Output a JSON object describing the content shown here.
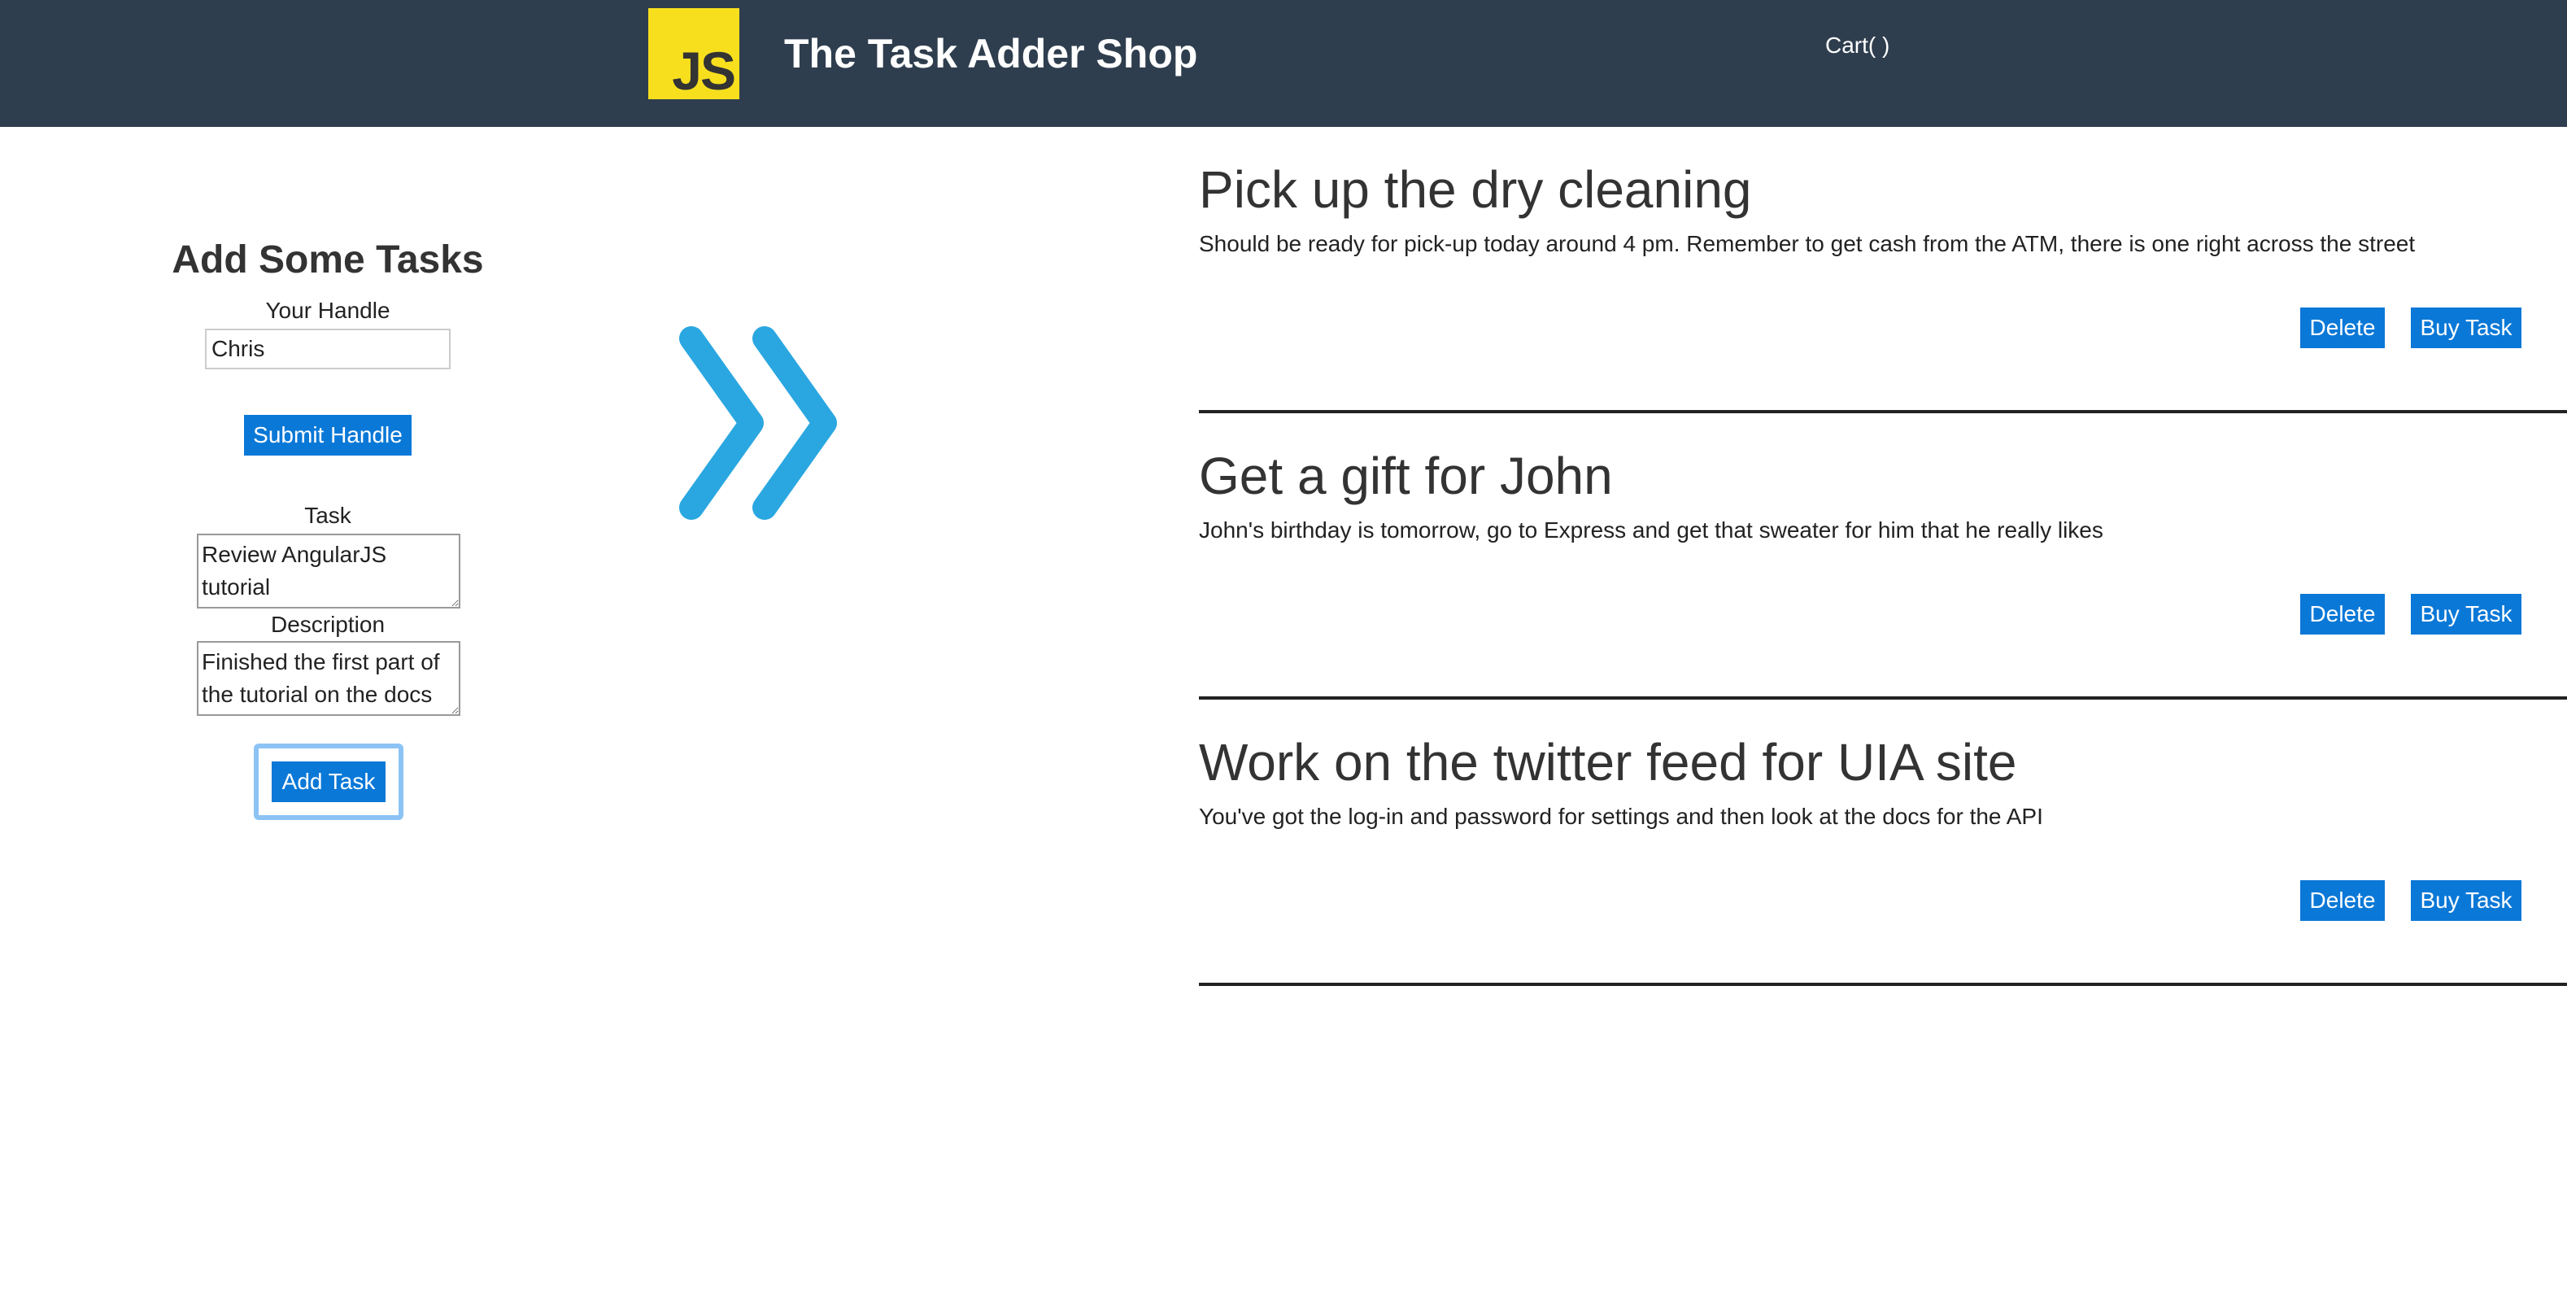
{
  "header": {
    "logo_text": "JS",
    "title": "The Task Adder Shop",
    "cart_label": "Cart( )"
  },
  "form": {
    "title": "Add Some Tasks",
    "handle_label": "Your Handle",
    "handle_value": "Chris",
    "submit_handle_label": "Submit Handle",
    "task_label": "Task",
    "task_value": "Review AngularJS tutorial",
    "description_label": "Description",
    "description_value": "Finished the first part of the tutorial on the docs",
    "add_task_label": "Add Task"
  },
  "tasks": [
    {
      "title": "Pick up the dry cleaning",
      "description": "Should be ready for pick-up today around 4 pm. Remember to get cash from the ATM, there is one right across the street",
      "delete_label": "Delete",
      "buy_label": "Buy Task"
    },
    {
      "title": "Get a gift for John",
      "description": "John's birthday is tomorrow, go to Express and get that sweater for him that he really likes",
      "delete_label": "Delete",
      "buy_label": "Buy Task"
    },
    {
      "title": "Work on the twitter feed for UIA site",
      "description": "You've got the log-in and password for settings and then look at the docs for the API",
      "delete_label": "Delete",
      "buy_label": "Buy Task"
    }
  ],
  "colors": {
    "header_bg": "#2f3e4e",
    "logo_bg": "#f7df1e",
    "button_bg": "#0a78d7",
    "arrow": "#2aa7e0",
    "focus_ring": "#8cc3f5"
  },
  "icons": {
    "logo": "js-logo-icon",
    "arrow": "double-chevron-right-icon"
  }
}
